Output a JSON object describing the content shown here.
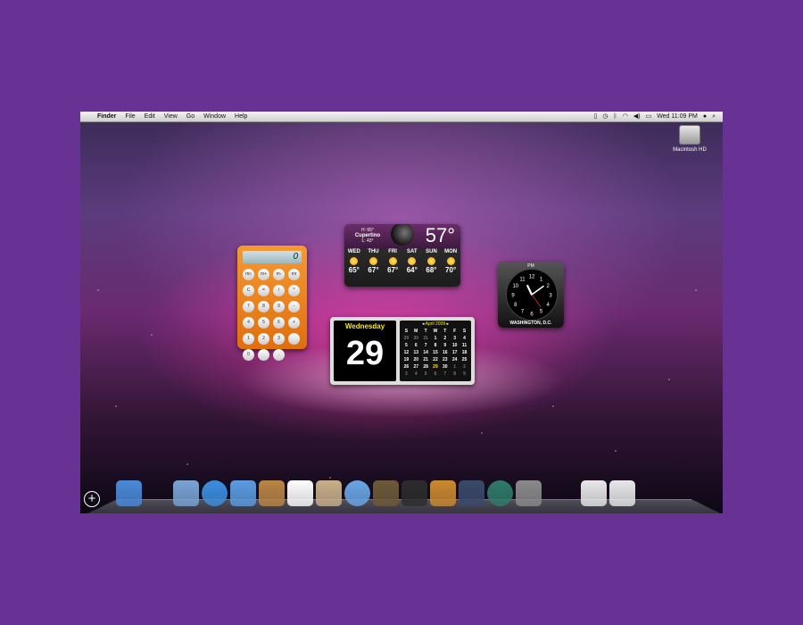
{
  "menubar": {
    "apple": "",
    "app": "Finder",
    "menus": [
      "File",
      "Edit",
      "View",
      "Go",
      "Window",
      "Help"
    ],
    "clock": "Wed 11:09 PM"
  },
  "desktop": {
    "hd_label": "Macintosh HD"
  },
  "calculator": {
    "display": "0",
    "keys": [
      "mc",
      "m+",
      "m-",
      "mr",
      "C",
      "=",
      "/",
      "*",
      "7",
      "8",
      "9",
      "-",
      "4",
      "5",
      "6",
      "+",
      "1",
      "2",
      "3",
      "",
      "0",
      "",
      "."
    ]
  },
  "weather": {
    "hilo_hi": "H: 65°",
    "city": "Cupertino",
    "hilo_lo": "L: 43°",
    "current": "57°",
    "days": [
      {
        "d": "WED",
        "t": "65°"
      },
      {
        "d": "THU",
        "t": "67°"
      },
      {
        "d": "FRI",
        "t": "67°"
      },
      {
        "d": "SAT",
        "t": "64°"
      },
      {
        "d": "SUN",
        "t": "68°"
      },
      {
        "d": "MON",
        "t": "70°"
      }
    ]
  },
  "clock": {
    "ampm": "PM",
    "city": "WASHINGTON, D.C.",
    "time": "11:09",
    "numerals": [
      "12",
      "1",
      "2",
      "3",
      "4",
      "5",
      "6",
      "7",
      "8",
      "9",
      "10",
      "11"
    ]
  },
  "date": {
    "weekday": "Wednesday",
    "day": "29",
    "month": "April 2009",
    "dow": [
      "S",
      "M",
      "T",
      "W",
      "T",
      "F",
      "S"
    ],
    "weeks": [
      [
        "29",
        "30",
        "31",
        "1",
        "2",
        "3",
        "4"
      ],
      [
        "5",
        "6",
        "7",
        "8",
        "9",
        "10",
        "11"
      ],
      [
        "12",
        "13",
        "14",
        "15",
        "16",
        "17",
        "18"
      ],
      [
        "19",
        "20",
        "21",
        "22",
        "23",
        "24",
        "25"
      ],
      [
        "26",
        "27",
        "28",
        "29",
        "30",
        "1",
        "2"
      ],
      [
        "3",
        "4",
        "5",
        "6",
        "7",
        "8",
        "9"
      ]
    ]
  },
  "dock": {
    "add": "+",
    "apps": [
      {
        "name": "finder",
        "color": "#4a8ad8"
      },
      {
        "name": "dashboard",
        "color": "#333"
      },
      {
        "name": "mail",
        "color": "#7aa4d6"
      },
      {
        "name": "safari",
        "color": "#3b8fe0"
      },
      {
        "name": "ichat",
        "color": "#5a9ce0"
      },
      {
        "name": "address-book",
        "color": "#b98545"
      },
      {
        "name": "ical",
        "color": "#ffffff"
      },
      {
        "name": "preview",
        "color": "#c8b08a"
      },
      {
        "name": "itunes",
        "color": "#6aa6e6"
      },
      {
        "name": "iphoto",
        "color": "#6e5a3a"
      },
      {
        "name": "imovie",
        "color": "#2c2c2c"
      },
      {
        "name": "garageband",
        "color": "#c98a30"
      },
      {
        "name": "spaces",
        "color": "#3a4a6a"
      },
      {
        "name": "time-machine",
        "color": "#2f7b6a"
      },
      {
        "name": "system-preferences",
        "color": "#8a8a8a"
      },
      {
        "name": "downloads",
        "color": "#ddd"
      },
      {
        "name": "documents-1",
        "color": "#e8e8e8"
      },
      {
        "name": "documents-2",
        "color": "#e8e8e8"
      },
      {
        "name": "trash",
        "color": "#bbb"
      }
    ]
  }
}
